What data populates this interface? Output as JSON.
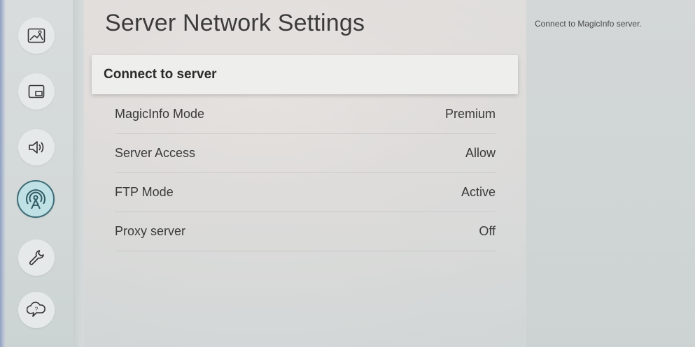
{
  "sidebar": {
    "items": [
      {
        "icon": "picture-icon",
        "active": false
      },
      {
        "icon": "pip-icon",
        "active": false
      },
      {
        "icon": "sound-icon",
        "active": false
      },
      {
        "icon": "network-icon",
        "active": true
      },
      {
        "icon": "wrench-icon",
        "active": false
      },
      {
        "icon": "support-icon",
        "active": false
      }
    ]
  },
  "main": {
    "title": "Server Network Settings",
    "focused_item": "Connect to server",
    "items": [
      {
        "label": "MagicInfo Mode",
        "value": "Premium"
      },
      {
        "label": "Server Access",
        "value": "Allow"
      },
      {
        "label": "FTP Mode",
        "value": "Active"
      },
      {
        "label": "Proxy server",
        "value": "Off"
      }
    ]
  },
  "help": {
    "text": "Connect to MagicInfo server."
  },
  "colors": {
    "active_ring": "#3e6d77",
    "active_fill": "#bfe0e4",
    "focus_bg": "#eeeeed"
  }
}
